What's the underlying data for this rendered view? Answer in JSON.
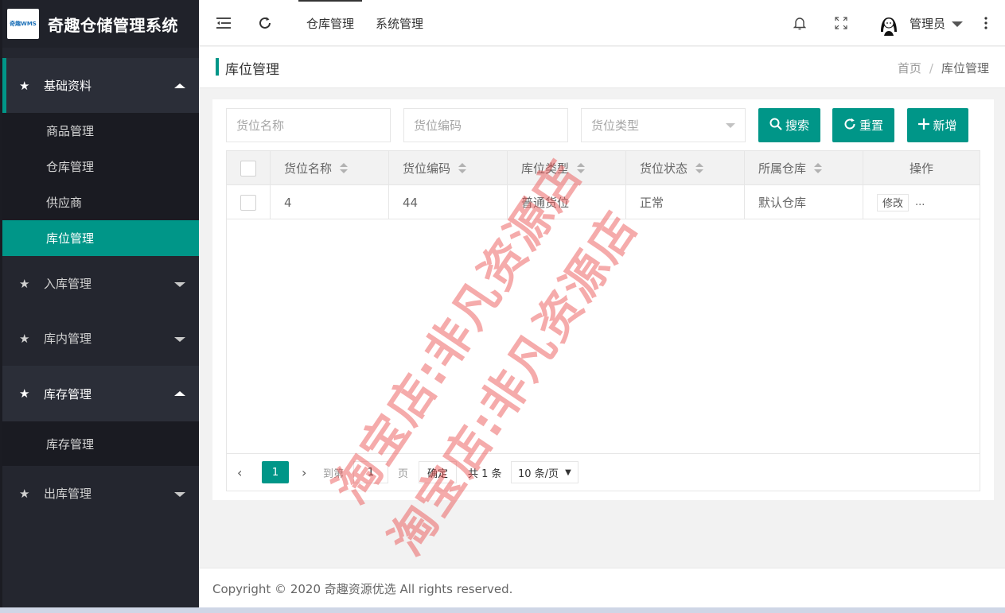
{
  "app": {
    "logo_text": "奇趣WMS",
    "title": "奇趣仓储管理系统"
  },
  "sidebar": {
    "groups": [
      {
        "label": "基础资料",
        "expanded": true,
        "items": [
          "商品管理",
          "仓库管理",
          "供应商",
          "库位管理"
        ],
        "active_item": "库位管理"
      },
      {
        "label": "入库管理",
        "expanded": false
      },
      {
        "label": "库内管理",
        "expanded": false
      },
      {
        "label": "库存管理",
        "expanded": true,
        "items": [
          "库存管理"
        ]
      },
      {
        "label": "出库管理",
        "expanded": false
      }
    ]
  },
  "header": {
    "tabs": [
      "仓库管理",
      "系统管理"
    ],
    "active_tab": "仓库管理",
    "user_name": "管理员",
    "icons": [
      "menu-fold-icon",
      "refresh-icon",
      "bell-icon",
      "fullscreen-icon",
      "more-vertical-icon"
    ]
  },
  "page": {
    "title": "库位管理",
    "breadcrumb": [
      "首页",
      "库位管理"
    ]
  },
  "filters": {
    "name_placeholder": "货位名称",
    "code_placeholder": "货位编码",
    "type_placeholder": "货位类型",
    "search_label": "搜索",
    "reset_label": "重置",
    "add_label": "新增"
  },
  "table": {
    "columns": [
      "货位名称",
      "货位编码",
      "库位类型",
      "货位状态",
      "所属仓库",
      "操作"
    ],
    "rows": [
      {
        "name": "4",
        "code": "44",
        "type": "普通货位",
        "status": "正常",
        "warehouse": "默认仓库",
        "edit_label": "修改",
        "more_label": "..."
      }
    ]
  },
  "pagination": {
    "current_page": "1",
    "goto_prefix": "到第",
    "goto_value": "1",
    "goto_suffix": "页",
    "confirm_label": "确定",
    "total_text": "共 1 条",
    "page_size": "10 条/页"
  },
  "footer": {
    "copyright": "Copyright © 2020 奇趣资源优选 All rights reserved."
  },
  "watermark": {
    "text": "淘宝店:非凡资源店"
  },
  "colors": {
    "accent": "#009688",
    "sidebar_bg": "#24262f",
    "watermark": "#eb5050"
  }
}
